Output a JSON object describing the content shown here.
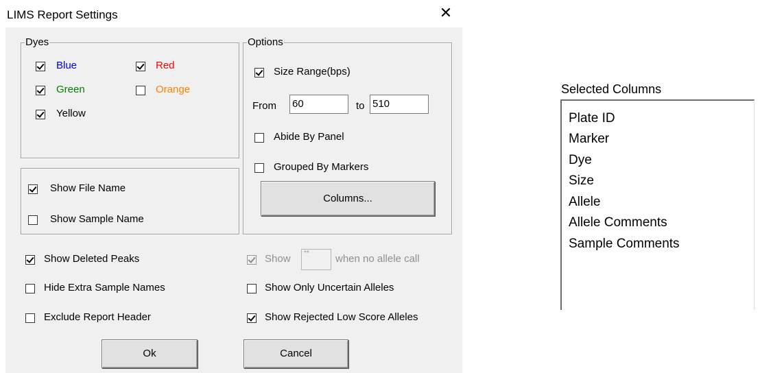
{
  "dialog": {
    "title": "LIMS Report Settings",
    "close_glyph": "✕",
    "dyes": {
      "legend": "Dyes",
      "items": [
        {
          "label": "Blue",
          "checked": true,
          "color": "#0000ff"
        },
        {
          "label": "Red",
          "checked": true,
          "color": "#ff0000"
        },
        {
          "label": "Green",
          "checked": true,
          "color": "#008000"
        },
        {
          "label": "Orange",
          "checked": false,
          "color": "#ff8000"
        },
        {
          "label": "Yellow",
          "checked": true,
          "color": "#000000"
        }
      ]
    },
    "names": {
      "show_file_name": {
        "label": "Show File Name",
        "checked": true
      },
      "show_sample_name": {
        "label": "Show Sample Name",
        "checked": false
      }
    },
    "options": {
      "legend": "Options",
      "size_range": {
        "label": "Size Range(bps)",
        "checked": true
      },
      "from_label": "From",
      "from_value": "60",
      "to_label": "to",
      "to_value": "510",
      "abide_by_panel": {
        "label": "Abide By Panel",
        "checked": false
      },
      "grouped_by_markers": {
        "label": "Grouped By Markers",
        "checked": false
      },
      "columns_button": "Columns..."
    },
    "bottom_left": {
      "show_deleted_peaks": {
        "label": "Show Deleted Peaks",
        "checked": true
      },
      "hide_extra_sample_names": {
        "label": "Hide Extra Sample Names",
        "checked": false
      },
      "exclude_report_header": {
        "label": "Exclude Report Header",
        "checked": false
      }
    },
    "bottom_right": {
      "show_label": "Show",
      "show_value": "**",
      "show_suffix": "when no allele call",
      "show_checked": true,
      "show_only_uncertain": {
        "label": "Show Only Uncertain Alleles",
        "checked": false
      },
      "show_rejected_low_score": {
        "label": "Show Rejected Low Score Alleles",
        "checked": true
      }
    },
    "ok_button": "Ok",
    "cancel_button": "Cancel"
  },
  "selected_columns": {
    "title": "Selected Columns",
    "items": [
      "Plate ID",
      "Marker",
      "Dye",
      "Size",
      "Allele",
      "Allele Comments",
      "Sample Comments"
    ]
  }
}
